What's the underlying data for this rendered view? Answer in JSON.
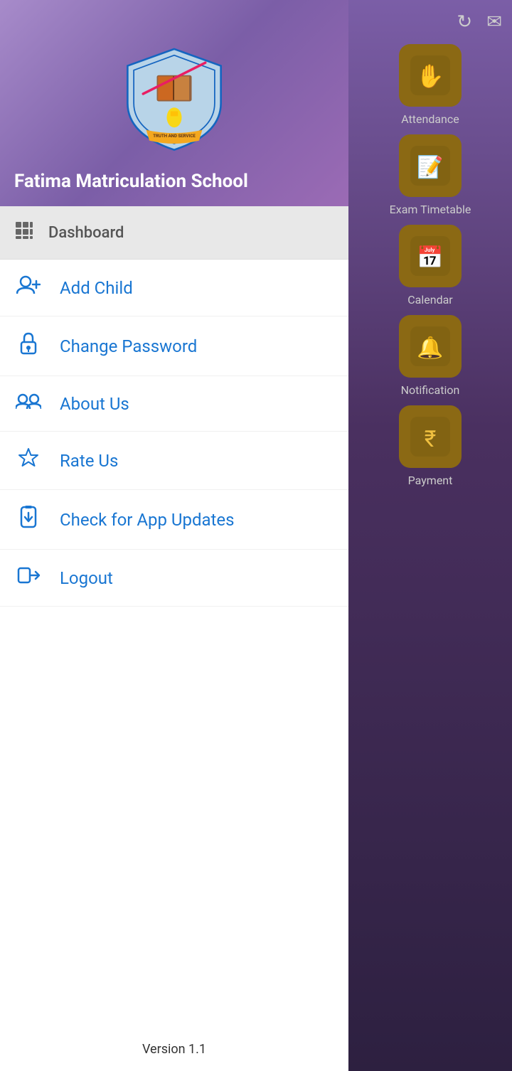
{
  "header": {
    "school_name": "Fatima Matriculation School"
  },
  "dashboard": {
    "label": "Dashboard"
  },
  "menu": {
    "items": [
      {
        "id": "add-child",
        "label": "Add Child",
        "icon": "👤+"
      },
      {
        "id": "change-password",
        "label": "Change Password",
        "icon": "🔒"
      },
      {
        "id": "about-us",
        "label": "About Us",
        "icon": "👥"
      },
      {
        "id": "rate-us",
        "label": "Rate Us",
        "icon": "⭐"
      },
      {
        "id": "check-updates",
        "label": "Check for App Updates",
        "icon": "📲"
      },
      {
        "id": "logout",
        "label": "Logout",
        "icon": "🚪"
      }
    ]
  },
  "version": "Version 1.1",
  "right_panel": {
    "top_icons": [
      {
        "id": "refresh",
        "symbol": "↻"
      },
      {
        "id": "mail",
        "symbol": "✉"
      }
    ],
    "grid_items": [
      {
        "id": "attendance",
        "label": "Attendance",
        "emoji": "🙌"
      },
      {
        "id": "exam-timetable",
        "label": "Exam Timetable",
        "emoji": "📋"
      },
      {
        "id": "calendar",
        "label": "Calendar",
        "emoji": "📅"
      },
      {
        "id": "notification",
        "label": "Notification",
        "emoji": "🔔"
      },
      {
        "id": "payment",
        "label": "Payment",
        "emoji": "₹"
      }
    ]
  },
  "icons": {
    "grid_dots": "⊞",
    "add_child": "person_add",
    "lock": "🔒",
    "group": "👥",
    "star": "⭐",
    "phone_download": "📲",
    "logout_arrow": "🚪"
  }
}
